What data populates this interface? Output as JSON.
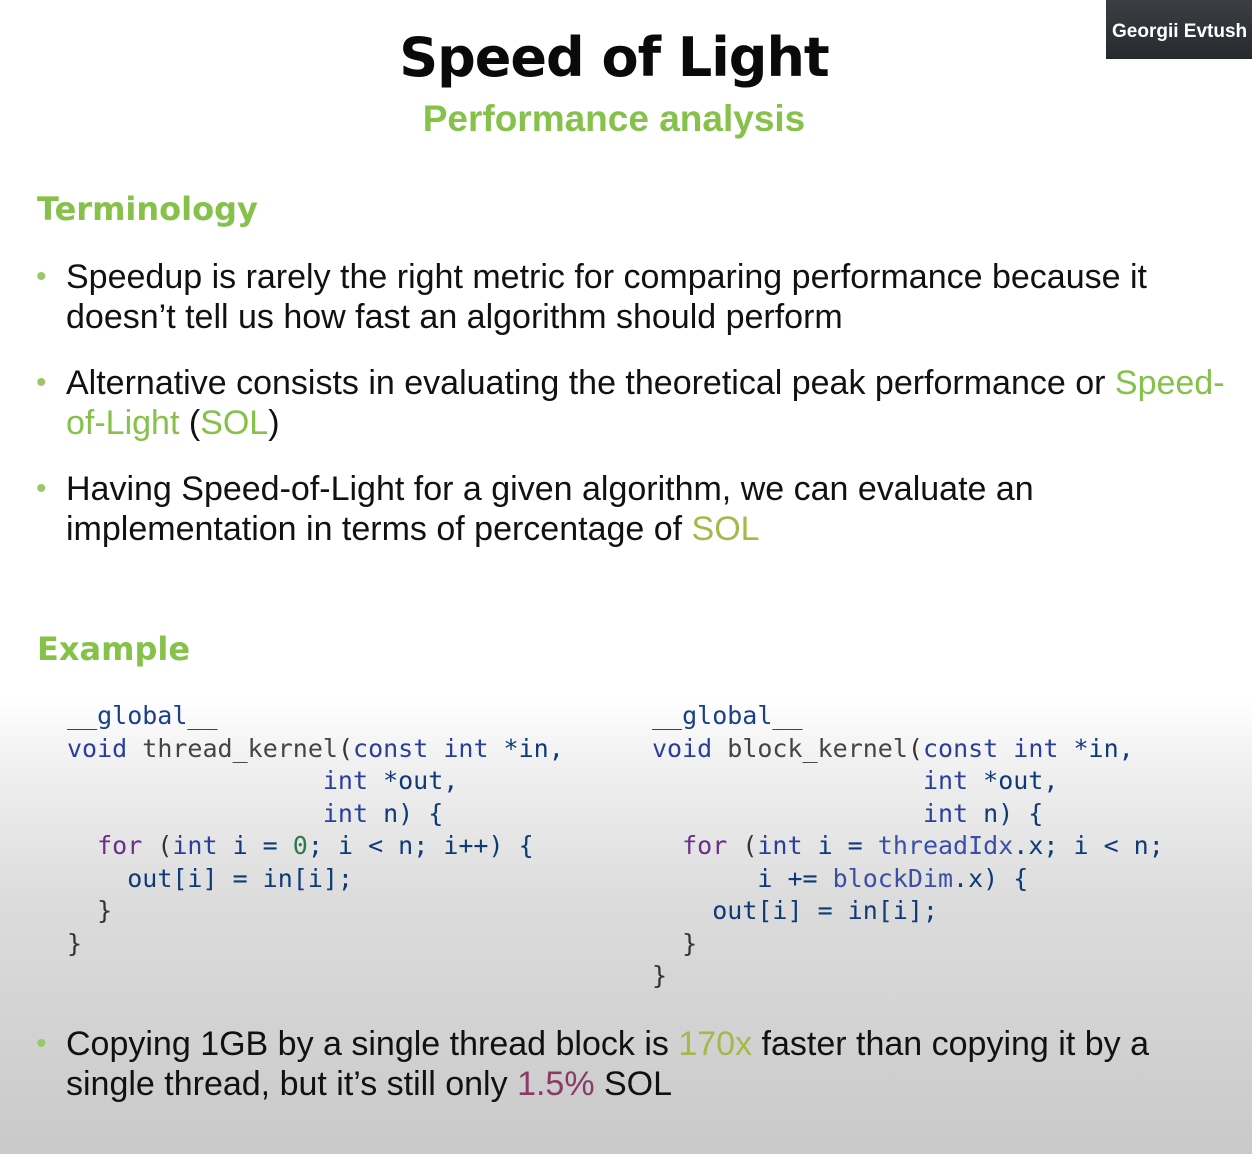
{
  "slide": {
    "title": "Speed of Light",
    "subtitle": "Performance analysis"
  },
  "webcam": {
    "participant_name": "Georgii Evtush"
  },
  "terminology": {
    "heading": "Terminology",
    "bullet1": "Speedup is rarely the right metric for comparing performance because it doesn’t tell us how fast an algorithm should perform",
    "bullet2": {
      "part1": "Alternative consists in evaluating the theoretical peak performance or ",
      "highlight1": "Speed-of-Light",
      "part2": " (",
      "highlight2": "SOL",
      "part3": ")"
    },
    "bullet3": {
      "part1": "Having Speed-of-Light for a given algorithm, we can evaluate an implementation in terms of percentage of ",
      "highlight": "SOL"
    }
  },
  "example": {
    "heading": "Example",
    "code_left": {
      "decorator": "__global__",
      "void_kw": "void",
      "func_name": "thread_kernel",
      "paren_open": "(",
      "const_kw": "const",
      "int_kw1": "int",
      "param1": " *in,",
      "int_kw2": "int",
      "param2": " *out,",
      "int_kw3": "int",
      "param3": " n) {",
      "for_kw": "for",
      "loop_open": " (",
      "int_kw4": "int",
      "loop_var_init": " i = ",
      "zero": "0",
      "loop_rest": "; i < n; i++) {",
      "body": "out[i] = in[i];",
      "close1": "}",
      "close2": "}"
    },
    "code_right": {
      "decorator": "__global__",
      "void_kw": "void",
      "func_name": "block_kernel",
      "paren_open": "(",
      "const_kw": "const",
      "int_kw1": "int",
      "param1": " *in,",
      "int_kw2": "int",
      "param2": " *out,",
      "int_kw3": "int",
      "param3": " n) {",
      "for_kw": "for",
      "loop_open": " (",
      "int_kw4": "int",
      "loop_var_init": " i = ",
      "thread_idx": "threadIdx",
      "loop_rest": ".x; i < n;",
      "incr_start": "i += ",
      "block_dim": "blockDim",
      "incr_end": ".x) {",
      "body": "out[i] = in[i];",
      "close1": "}",
      "close2": "}"
    },
    "conclusion": {
      "part1": "Copying 1GB by a single thread block is ",
      "highlight1": "170x",
      "part2": " faster than copying it by a single thread, but it’s still only ",
      "highlight2": "1.5%",
      "part3": " SOL"
    }
  },
  "colors": {
    "accent_green": "#86c14a",
    "accent_olive": "#a6b84a",
    "accent_rose": "#8a3a66",
    "code_blue": "#0e3a78"
  }
}
